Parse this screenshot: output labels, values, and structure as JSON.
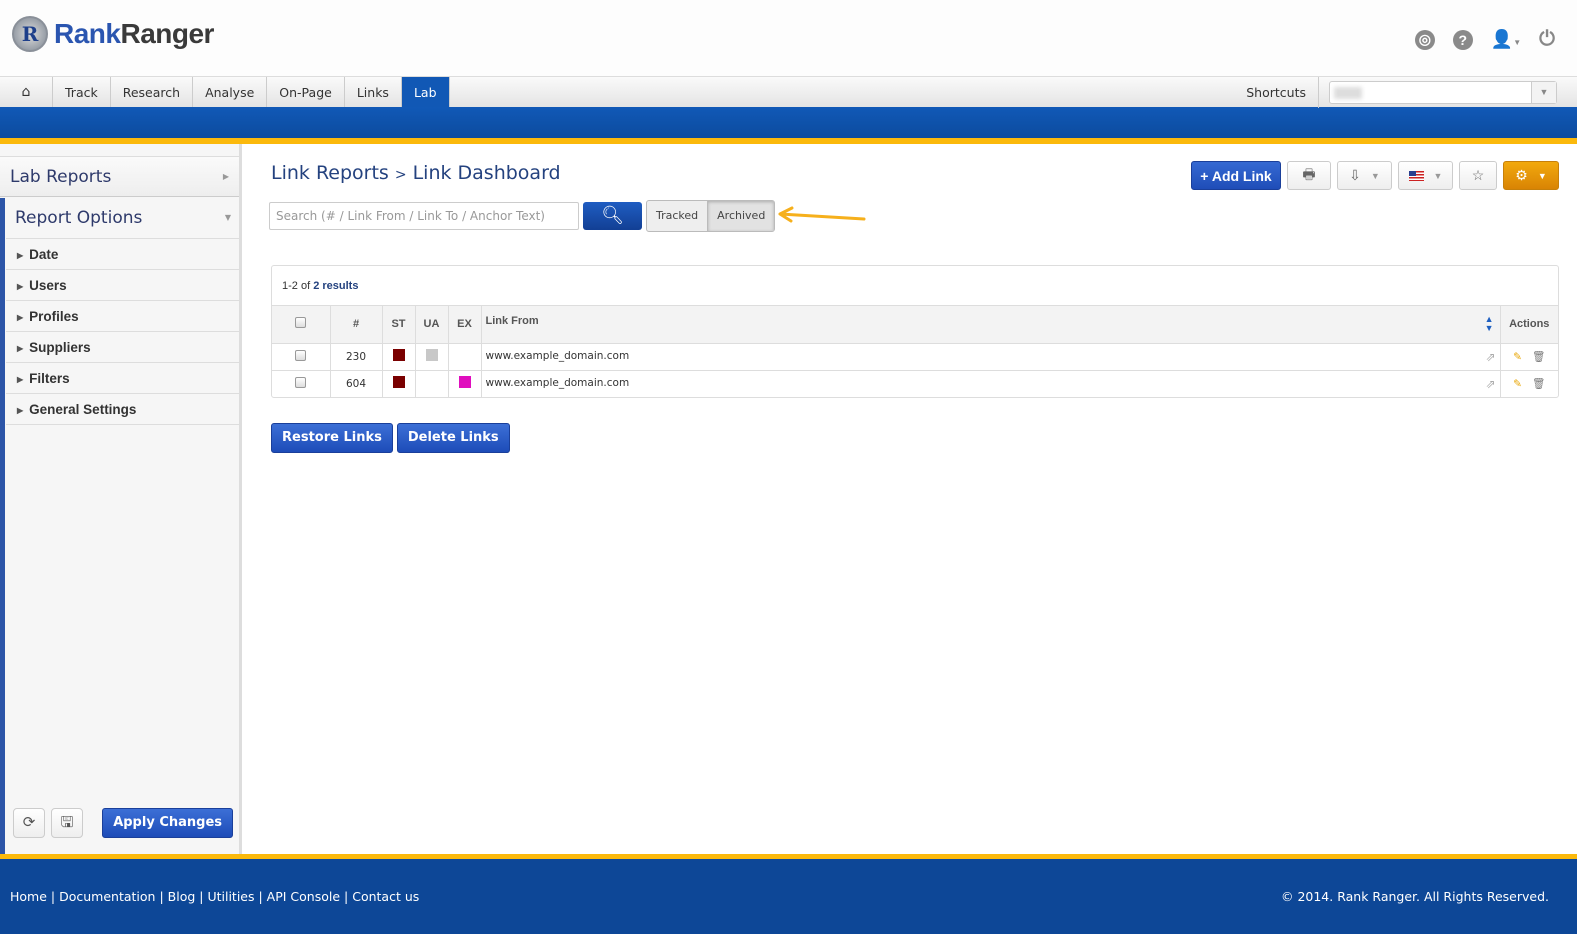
{
  "header": {
    "logo_a": "Rank",
    "logo_b": "Ranger",
    "logo_letter": "R"
  },
  "nav": {
    "tabs": [
      "Track",
      "Research",
      "Analyse",
      "On-Page",
      "Links",
      "Lab"
    ],
    "active": "Lab",
    "shortcuts_label": "Shortcuts"
  },
  "sidebar": {
    "lab_reports": "Lab Reports",
    "report_options": "Report Options",
    "items": [
      "Date",
      "Users",
      "Profiles",
      "Suppliers",
      "Filters",
      "General Settings"
    ],
    "apply": "Apply Changes"
  },
  "main": {
    "breadcrumb": [
      "Link Reports",
      "Link Dashboard"
    ],
    "breadcrumb_sep": ">",
    "search_placeholder": "Search (# / Link From / Link To / Anchor Text)",
    "toggle": [
      "Tracked",
      "Archived"
    ],
    "toggle_active": "Archived",
    "add_link": "+ Add Link",
    "results": {
      "range": "1-2 of",
      "total": "2 results"
    },
    "columns": [
      "#",
      "ST",
      "UA",
      "EX",
      "Link From",
      "Actions"
    ],
    "rows": [
      {
        "id": "230",
        "st": "#7a0000",
        "ua": "#c8c8c8",
        "ex": null,
        "link_from": "www.example_domain.com"
      },
      {
        "id": "604",
        "st": "#7a0000",
        "ua": null,
        "ex": "#e00ebe",
        "link_from": "www.example_domain.com"
      }
    ],
    "restore": "Restore Links",
    "delete": "Delete Links"
  },
  "footer": {
    "links": [
      "Home",
      "Documentation",
      "Blog",
      "Utilities",
      "API Console",
      "Contact us"
    ],
    "copyright": "© 2014. Rank Ranger. All Rights Reserved."
  }
}
